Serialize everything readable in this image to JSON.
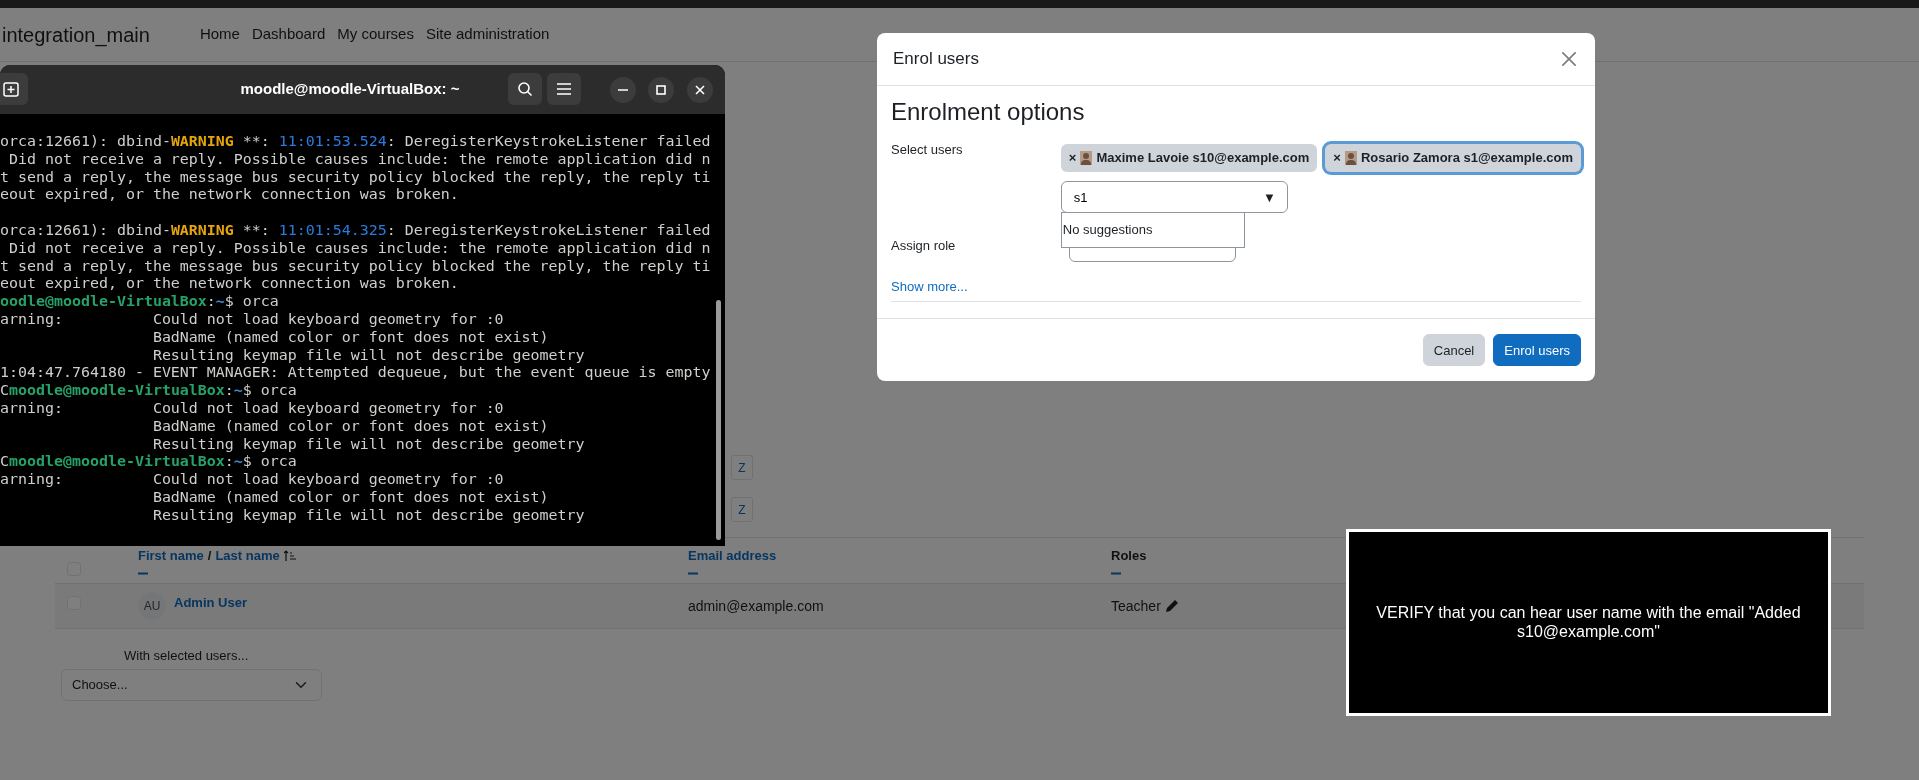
{
  "navbar": {
    "brand": "integration_main",
    "links": [
      "Home",
      "Dashboard",
      "My courses",
      "Site administration"
    ]
  },
  "initials_filters": [
    {
      "letter": "Z"
    },
    {
      "letter": "Z"
    }
  ],
  "participants_table": {
    "header_checkbox": {
      "checked": false
    },
    "columns": [
      {
        "kind": "name",
        "first": "First name",
        "separator": "/",
        "last": "Last name"
      },
      {
        "kind": "link",
        "label": "Email address"
      },
      {
        "kind": "plain",
        "label": "Roles"
      }
    ],
    "rows": [
      {
        "checked": false,
        "initials": "AU",
        "name": "Admin User",
        "email": "admin@example.com",
        "role": "Teacher"
      }
    ]
  },
  "bulk_actions": {
    "label": "With selected users...",
    "select": "Choose..."
  },
  "terminal": {
    "title": "moodle@moodle-VirtualBox: ~",
    "lines": [
      {
        "segments": [
          {
            "kind": "plain",
            "text": "orca:12661): dbind-"
          },
          {
            "kind": "warning",
            "text": "WARNING"
          },
          {
            "kind": "plain",
            "text": " **: "
          },
          {
            "kind": "time",
            "text": "11:01:53.524"
          },
          {
            "kind": "plain",
            "text": ": DeregisterKeystrokeListener failed"
          }
        ]
      },
      {
        "segments": [
          {
            "kind": "plain",
            "text": " Did not receive a reply. Possible causes include: the remote application did n"
          }
        ]
      },
      {
        "segments": [
          {
            "kind": "plain",
            "text": "t send a reply, the message bus security policy blocked the reply, the reply ti"
          }
        ]
      },
      {
        "segments": [
          {
            "kind": "plain",
            "text": "eout expired, or the network connection was broken."
          }
        ]
      },
      {
        "gap_before": true,
        "segments": [
          {
            "kind": "plain",
            "text": "orca:12661): dbind-"
          },
          {
            "kind": "warning",
            "text": "WARNING"
          },
          {
            "kind": "plain",
            "text": " **: "
          },
          {
            "kind": "time",
            "text": "11:01:54.325"
          },
          {
            "kind": "plain",
            "text": ": DeregisterKeystrokeListener failed"
          }
        ]
      },
      {
        "segments": [
          {
            "kind": "plain",
            "text": " Did not receive a reply. Possible causes include: the remote application did n"
          }
        ]
      },
      {
        "segments": [
          {
            "kind": "plain",
            "text": "t send a reply, the message bus security policy blocked the reply, the reply ti"
          }
        ]
      },
      {
        "segments": [
          {
            "kind": "plain",
            "text": "eout expired, or the network connection was broken."
          }
        ]
      },
      {
        "segments": [
          {
            "kind": "prompt",
            "text": "oodle@moodle-VirtualBox"
          },
          {
            "kind": "plain",
            "text": ":"
          },
          {
            "kind": "path",
            "text": "~"
          },
          {
            "kind": "plain",
            "text": "$ orca"
          }
        ]
      },
      {
        "segments": [
          {
            "kind": "plain",
            "text": "arning:          Could not load keyboard geometry for :0"
          }
        ]
      },
      {
        "segments": [
          {
            "kind": "plain",
            "text": "                 BadName (named color or font does not exist)"
          }
        ]
      },
      {
        "segments": [
          {
            "kind": "plain",
            "text": "                 Resulting keymap file will not describe geometry"
          }
        ]
      },
      {
        "segments": [
          {
            "kind": "plain",
            "text": "1:04:47.764180 - EVENT MANAGER: Attempted dequeue, but the event queue is empty"
          }
        ]
      },
      {
        "segments": [
          {
            "kind": "plain",
            "text": "C"
          },
          {
            "kind": "prompt",
            "text": "moodle@moodle-VirtualBox"
          },
          {
            "kind": "plain",
            "text": ":"
          },
          {
            "kind": "path",
            "text": "~"
          },
          {
            "kind": "plain",
            "text": "$ orca"
          }
        ]
      },
      {
        "segments": [
          {
            "kind": "plain",
            "text": "arning:          Could not load keyboard geometry for :0"
          }
        ]
      },
      {
        "segments": [
          {
            "kind": "plain",
            "text": "                 BadName (named color or font does not exist)"
          }
        ]
      },
      {
        "segments": [
          {
            "kind": "plain",
            "text": "                 Resulting keymap file will not describe geometry"
          }
        ]
      },
      {
        "segments": [
          {
            "kind": "plain",
            "text": "C"
          },
          {
            "kind": "prompt",
            "text": "moodle@moodle-VirtualBox"
          },
          {
            "kind": "plain",
            "text": ":"
          },
          {
            "kind": "path",
            "text": "~"
          },
          {
            "kind": "plain",
            "text": "$ orca"
          }
        ]
      },
      {
        "segments": [
          {
            "kind": "plain",
            "text": "arning:          Could not load keyboard geometry for :0"
          }
        ]
      },
      {
        "segments": [
          {
            "kind": "plain",
            "text": "                 BadName (named color or font does not exist)"
          }
        ]
      },
      {
        "segments": [
          {
            "kind": "plain",
            "text": "                 Resulting keymap file will not describe geometry"
          }
        ]
      }
    ]
  },
  "dialog": {
    "title": "Enrol users",
    "heading": "Enrolment options",
    "select_users_label": "Select users",
    "selected_users": [
      {
        "remove": "×",
        "label": "Maxime Lavoie s10@example.com",
        "selected": false
      },
      {
        "remove": "×",
        "label": "Rosario Zamora s1@example.com",
        "selected": true
      }
    ],
    "search_value": "s1",
    "toggle": "▼",
    "suggestions": "No suggestions",
    "assign_role_label": "Assign role",
    "show_more": "Show more...",
    "buttons": [
      {
        "kind": "secondary",
        "label": "Cancel"
      },
      {
        "kind": "primary",
        "label": "Enrol users"
      }
    ]
  },
  "verify_note": {
    "text": "VERIFY that you can hear user name with the email \"Added s10@example.com\""
  }
}
